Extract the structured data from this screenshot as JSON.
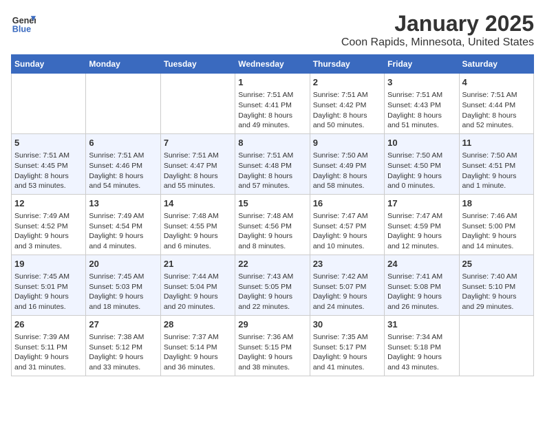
{
  "logo": {
    "line1": "General",
    "line2": "Blue"
  },
  "title": "January 2025",
  "subtitle": "Coon Rapids, Minnesota, United States",
  "days_of_week": [
    "Sunday",
    "Monday",
    "Tuesday",
    "Wednesday",
    "Thursday",
    "Friday",
    "Saturday"
  ],
  "weeks": [
    [
      {
        "day": "",
        "content": ""
      },
      {
        "day": "",
        "content": ""
      },
      {
        "day": "",
        "content": ""
      },
      {
        "day": "1",
        "content": "Sunrise: 7:51 AM\nSunset: 4:41 PM\nDaylight: 8 hours\nand 49 minutes."
      },
      {
        "day": "2",
        "content": "Sunrise: 7:51 AM\nSunset: 4:42 PM\nDaylight: 8 hours\nand 50 minutes."
      },
      {
        "day": "3",
        "content": "Sunrise: 7:51 AM\nSunset: 4:43 PM\nDaylight: 8 hours\nand 51 minutes."
      },
      {
        "day": "4",
        "content": "Sunrise: 7:51 AM\nSunset: 4:44 PM\nDaylight: 8 hours\nand 52 minutes."
      }
    ],
    [
      {
        "day": "5",
        "content": "Sunrise: 7:51 AM\nSunset: 4:45 PM\nDaylight: 8 hours\nand 53 minutes."
      },
      {
        "day": "6",
        "content": "Sunrise: 7:51 AM\nSunset: 4:46 PM\nDaylight: 8 hours\nand 54 minutes."
      },
      {
        "day": "7",
        "content": "Sunrise: 7:51 AM\nSunset: 4:47 PM\nDaylight: 8 hours\nand 55 minutes."
      },
      {
        "day": "8",
        "content": "Sunrise: 7:51 AM\nSunset: 4:48 PM\nDaylight: 8 hours\nand 57 minutes."
      },
      {
        "day": "9",
        "content": "Sunrise: 7:50 AM\nSunset: 4:49 PM\nDaylight: 8 hours\nand 58 minutes."
      },
      {
        "day": "10",
        "content": "Sunrise: 7:50 AM\nSunset: 4:50 PM\nDaylight: 9 hours\nand 0 minutes."
      },
      {
        "day": "11",
        "content": "Sunrise: 7:50 AM\nSunset: 4:51 PM\nDaylight: 9 hours\nand 1 minute."
      }
    ],
    [
      {
        "day": "12",
        "content": "Sunrise: 7:49 AM\nSunset: 4:52 PM\nDaylight: 9 hours\nand 3 minutes."
      },
      {
        "day": "13",
        "content": "Sunrise: 7:49 AM\nSunset: 4:54 PM\nDaylight: 9 hours\nand 4 minutes."
      },
      {
        "day": "14",
        "content": "Sunrise: 7:48 AM\nSunset: 4:55 PM\nDaylight: 9 hours\nand 6 minutes."
      },
      {
        "day": "15",
        "content": "Sunrise: 7:48 AM\nSunset: 4:56 PM\nDaylight: 9 hours\nand 8 minutes."
      },
      {
        "day": "16",
        "content": "Sunrise: 7:47 AM\nSunset: 4:57 PM\nDaylight: 9 hours\nand 10 minutes."
      },
      {
        "day": "17",
        "content": "Sunrise: 7:47 AM\nSunset: 4:59 PM\nDaylight: 9 hours\nand 12 minutes."
      },
      {
        "day": "18",
        "content": "Sunrise: 7:46 AM\nSunset: 5:00 PM\nDaylight: 9 hours\nand 14 minutes."
      }
    ],
    [
      {
        "day": "19",
        "content": "Sunrise: 7:45 AM\nSunset: 5:01 PM\nDaylight: 9 hours\nand 16 minutes."
      },
      {
        "day": "20",
        "content": "Sunrise: 7:45 AM\nSunset: 5:03 PM\nDaylight: 9 hours\nand 18 minutes."
      },
      {
        "day": "21",
        "content": "Sunrise: 7:44 AM\nSunset: 5:04 PM\nDaylight: 9 hours\nand 20 minutes."
      },
      {
        "day": "22",
        "content": "Sunrise: 7:43 AM\nSunset: 5:05 PM\nDaylight: 9 hours\nand 22 minutes."
      },
      {
        "day": "23",
        "content": "Sunrise: 7:42 AM\nSunset: 5:07 PM\nDaylight: 9 hours\nand 24 minutes."
      },
      {
        "day": "24",
        "content": "Sunrise: 7:41 AM\nSunset: 5:08 PM\nDaylight: 9 hours\nand 26 minutes."
      },
      {
        "day": "25",
        "content": "Sunrise: 7:40 AM\nSunset: 5:10 PM\nDaylight: 9 hours\nand 29 minutes."
      }
    ],
    [
      {
        "day": "26",
        "content": "Sunrise: 7:39 AM\nSunset: 5:11 PM\nDaylight: 9 hours\nand 31 minutes."
      },
      {
        "day": "27",
        "content": "Sunrise: 7:38 AM\nSunset: 5:12 PM\nDaylight: 9 hours\nand 33 minutes."
      },
      {
        "day": "28",
        "content": "Sunrise: 7:37 AM\nSunset: 5:14 PM\nDaylight: 9 hours\nand 36 minutes."
      },
      {
        "day": "29",
        "content": "Sunrise: 7:36 AM\nSunset: 5:15 PM\nDaylight: 9 hours\nand 38 minutes."
      },
      {
        "day": "30",
        "content": "Sunrise: 7:35 AM\nSunset: 5:17 PM\nDaylight: 9 hours\nand 41 minutes."
      },
      {
        "day": "31",
        "content": "Sunrise: 7:34 AM\nSunset: 5:18 PM\nDaylight: 9 hours\nand 43 minutes."
      },
      {
        "day": "",
        "content": ""
      }
    ]
  ]
}
